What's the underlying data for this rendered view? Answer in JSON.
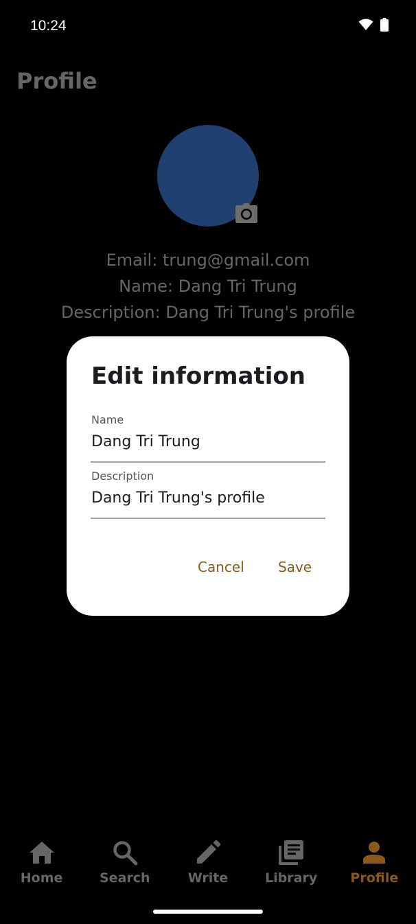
{
  "status_bar": {
    "time": "10:24",
    "icons": [
      "wifi-icon",
      "battery-icon"
    ]
  },
  "page": {
    "title": "Profile"
  },
  "profile": {
    "email_line": "Email: trung@gmail.com",
    "name_line": "Name: Dang Tri Trung",
    "description_line": "Description: Dang Tri Trung's profile",
    "avatar_color": "#213f6f",
    "avatar_edit_icon": "camera-icon"
  },
  "dialog": {
    "title": "Edit information",
    "name_label": "Name",
    "name_value": "Dang Tri Trung",
    "description_label": "Description",
    "description_value": "Dang Tri Trung's profile",
    "cancel_label": "Cancel",
    "save_label": "Save"
  },
  "nav": {
    "items": [
      {
        "label": "Home",
        "icon": "home-icon"
      },
      {
        "label": "Search",
        "icon": "search-icon"
      },
      {
        "label": "Write",
        "icon": "pencil-icon"
      },
      {
        "label": "Library",
        "icon": "library-icon"
      },
      {
        "label": "Profile",
        "icon": "person-icon",
        "active": true
      }
    ],
    "inactive_color": "#666666",
    "active_color": "#8a5a1c"
  },
  "colors": {
    "background": "#000000",
    "accent": "#8a5a1c",
    "dialog_background": "#ffffff"
  }
}
